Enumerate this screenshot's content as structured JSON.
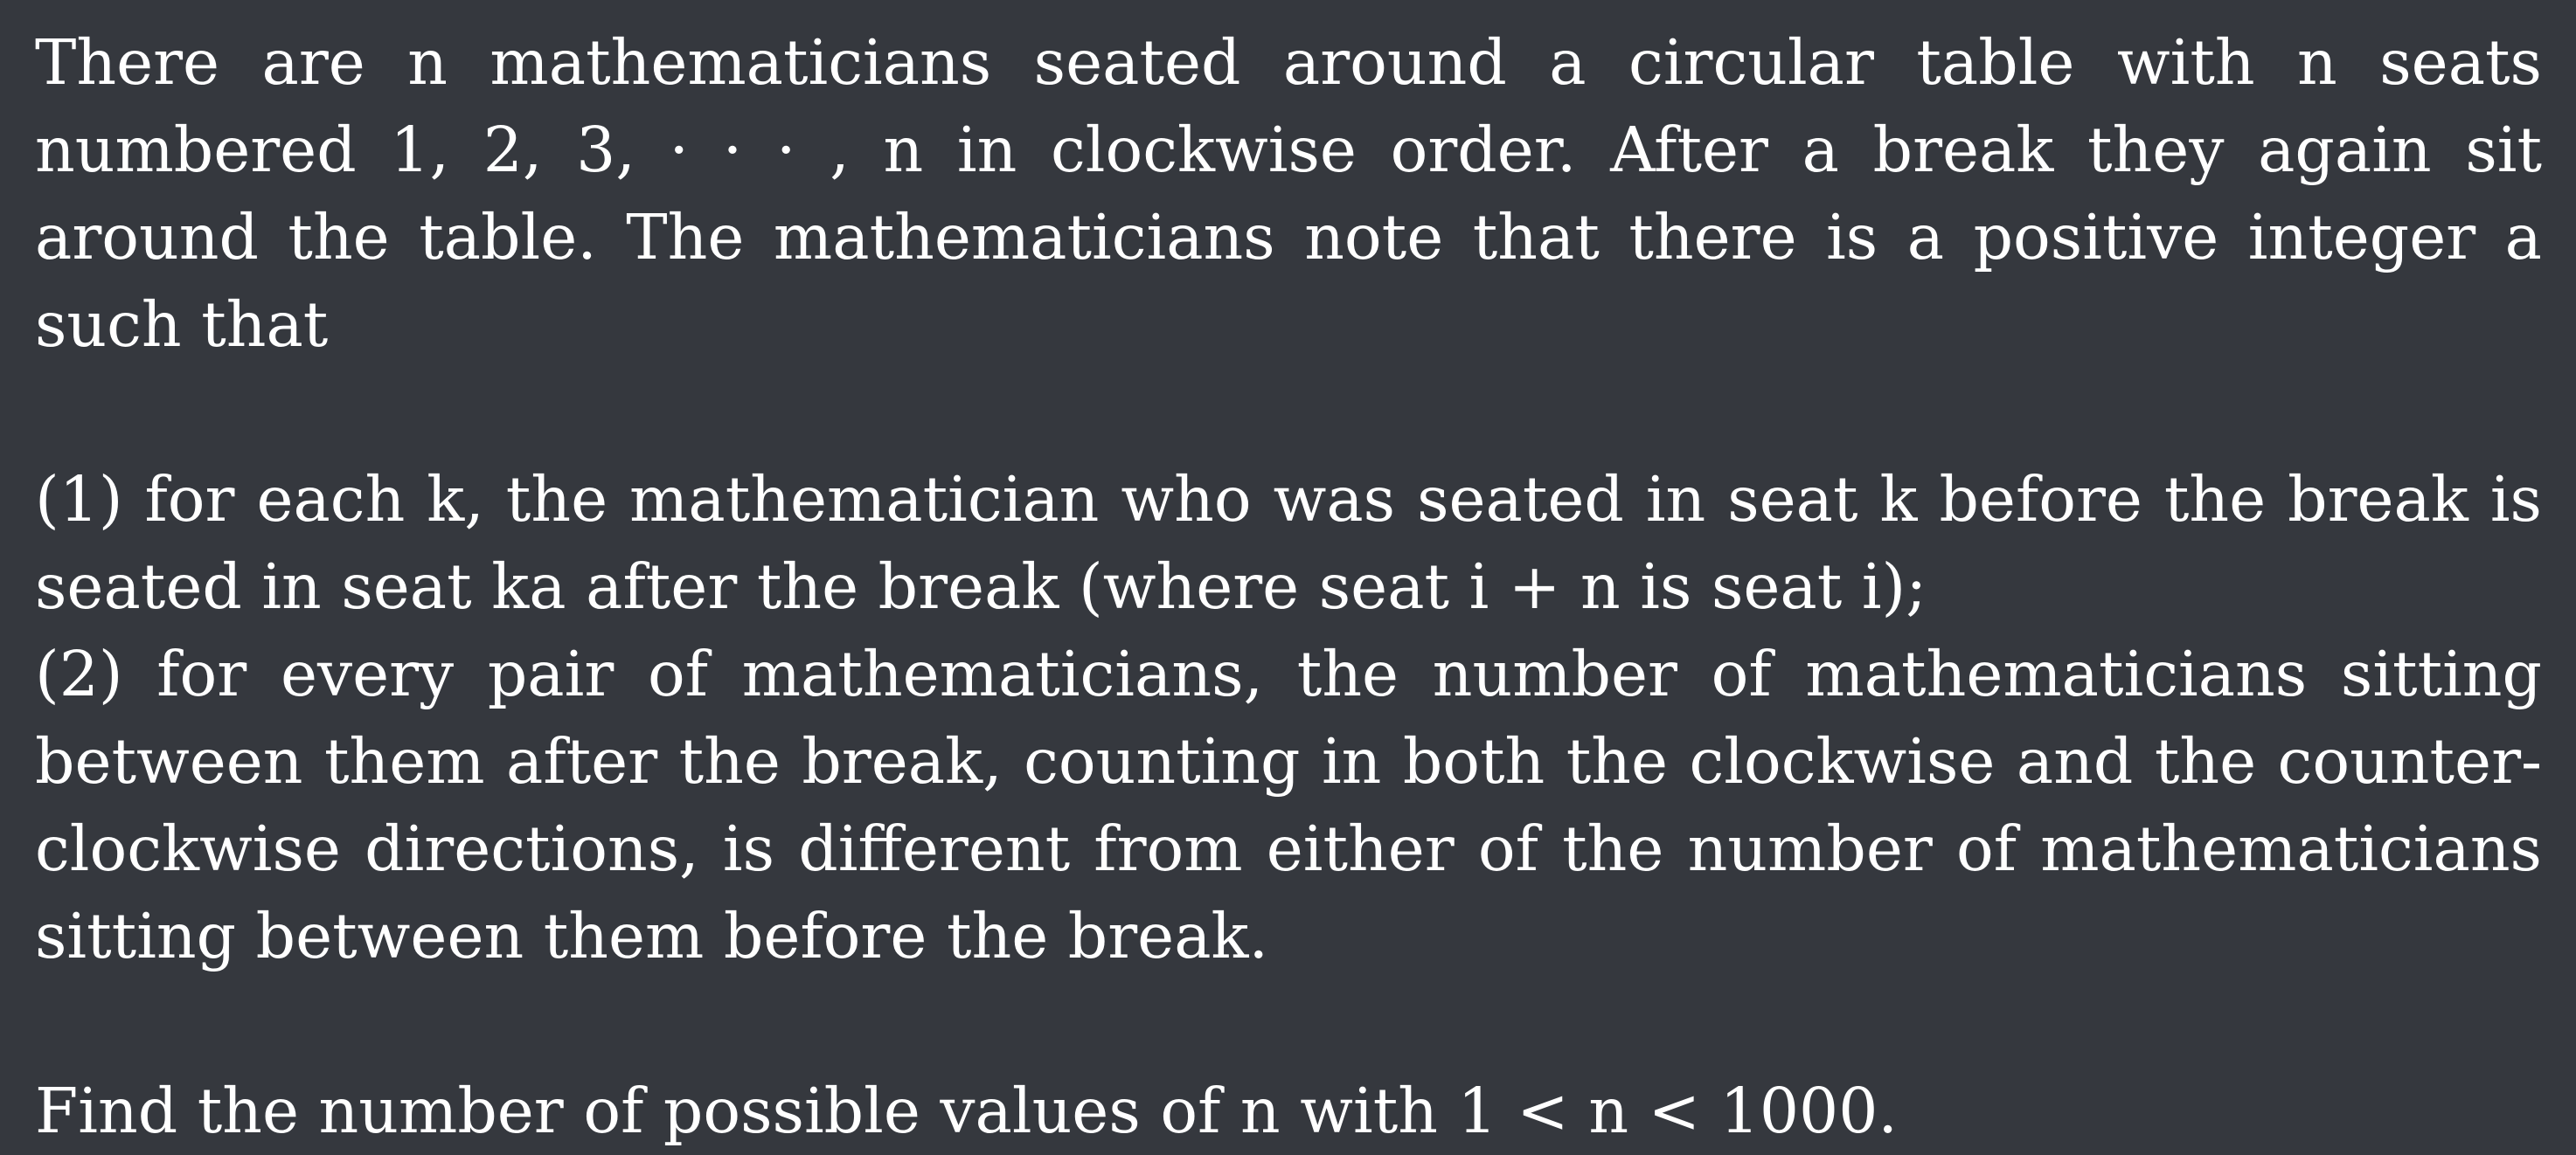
{
  "problem": {
    "intro": "There are n mathematicians seated around a circular table with n seats numbered 1, 2, 3, · · · , n in clockwise order. After a break they again sit around the table. The mathematicians note that there is a positive integer a such that",
    "condition_1": "(1) for each k, the mathematician who was seated in seat k before the break is seated in seat ka after the break (where seat i + n is seat i);",
    "condition_2": "(2) for every pair of mathematicians, the number of mathematicians sitting between them after the break, counting in both the clockwise and the counter-clockwise directions, is different from either of the number of mathematicians sitting between them before the break.",
    "question": "Find the number of possible values of n with 1 < n < 1000."
  }
}
